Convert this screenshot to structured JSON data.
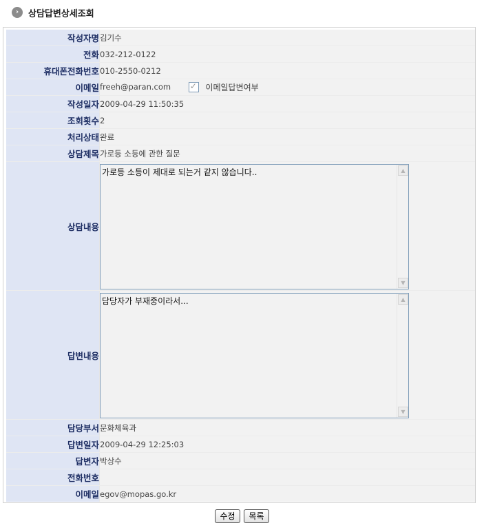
{
  "page": {
    "title": "상담답변상세조회",
    "title_icon": "arrow-right-circle-icon"
  },
  "fields": {
    "writer_name": {
      "label": "작성자명",
      "value": "김기수"
    },
    "phone": {
      "label": "전화",
      "value": "032-212-0122"
    },
    "mobile": {
      "label": "휴대폰전화번호",
      "value": "010-2550-0212"
    },
    "email": {
      "label": "이메일",
      "value": "freeh@paran.com",
      "checkbox_label": "이메일답변여부"
    },
    "written_date": {
      "label": "작성일자",
      "value": "2009-04-29 11:50:35"
    },
    "views": {
      "label": "조회횟수",
      "value": "2"
    },
    "status": {
      "label": "처리상태",
      "value": "완료"
    },
    "subject": {
      "label": "상담제목",
      "value": "가로등 소등에 관한 질문"
    },
    "content": {
      "label": "상담내용",
      "value": "가로등 소등이 제대로 되는거 같지 않습니다.."
    },
    "answer_content": {
      "label": "답변내용",
      "value": "담당자가 부재중이라서..."
    },
    "department": {
      "label": "담당부서",
      "value": "문화체육과"
    },
    "answer_date": {
      "label": "답변일자",
      "value": "2009-04-29 12:25:03"
    },
    "answerer": {
      "label": "답변자",
      "value": "박상수"
    },
    "answerer_phone": {
      "label": "전화번호",
      "value": ""
    },
    "answerer_email": {
      "label": "이메일",
      "value": "egov@mopas.go.kr"
    }
  },
  "buttons": {
    "edit": "수정",
    "list": "목록"
  },
  "colors": {
    "label_bg": "#dfe5f4",
    "label_text": "#1f2f64",
    "value_bg": "#f2f2f2"
  }
}
